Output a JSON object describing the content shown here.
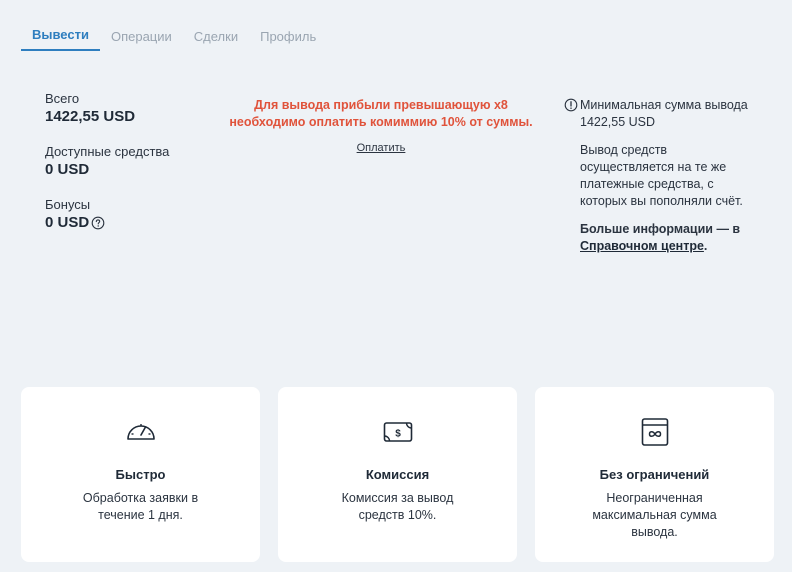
{
  "tabs": [
    {
      "label": "Вывести",
      "active": true
    },
    {
      "label": "Операции",
      "active": false
    },
    {
      "label": "Сделки",
      "active": false
    },
    {
      "label": "Профиль",
      "active": false
    }
  ],
  "stats": {
    "total_label": "Всего",
    "total_value": "1422,55 USD",
    "available_label": "Доступные средства",
    "available_value": "0 USD",
    "bonus_label": "Бонусы",
    "bonus_value": "0 USD"
  },
  "notice": {
    "line1": "Для вывода прибыли превышающую x8",
    "line2": "необходимо оплатить комиммию 10% от суммы.",
    "pay_link": "Оплатить"
  },
  "info": {
    "minimum": "Минимальная сумма вывода 1422,55 USD",
    "method": "Вывод средств осуществляется на те же платежные средства, с которых вы пополняли счёт.",
    "more_prefix": "Больше информации — в ",
    "more_link": "Справочном центре",
    "more_suffix": "."
  },
  "cards": [
    {
      "icon": "speedometer-icon",
      "title": "Быстро",
      "desc": "Обработка заявки в течение 1 дня."
    },
    {
      "icon": "banknote-icon",
      "title": "Комиссия",
      "desc": "Комиссия за вывод средств 10%."
    },
    {
      "icon": "infinity-window-icon",
      "title": "Без ограничений",
      "desc": "Неограниченная максимальная сумма вывода."
    }
  ],
  "colors": {
    "accent": "#2e7ebf",
    "warning_text": "#e0533b",
    "background": "#eef2f6",
    "card": "#ffffff"
  }
}
